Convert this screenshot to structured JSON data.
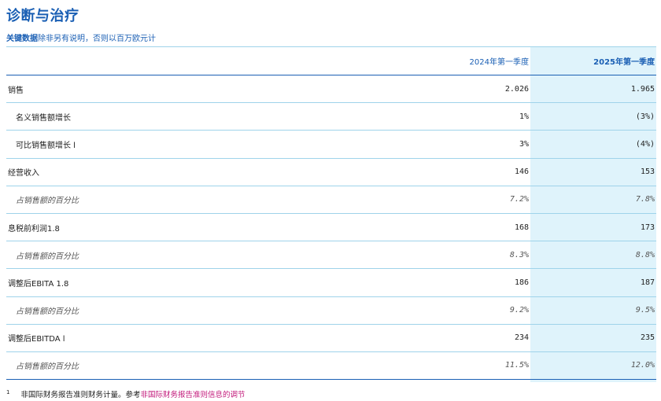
{
  "title": "诊断与治疗",
  "subtitle": {
    "strong": "关键数据",
    "rest": "除非另有说明，否则以百万欧元计"
  },
  "table": {
    "headers": {
      "label": "",
      "prev": "2024年第一季度",
      "curr": "2025年第一季度"
    },
    "rows": [
      {
        "label": "销售",
        "prev": "2.026",
        "curr": "1.965",
        "indent": false,
        "pct": false
      },
      {
        "label": "名义销售额增长",
        "prev": "1%",
        "curr": "(3%)",
        "indent": true,
        "pct": false
      },
      {
        "label": "可比销售额增长 l",
        "prev": "3%",
        "curr": "(4%)",
        "indent": true,
        "pct": false
      },
      {
        "label": "经营收入",
        "prev": "146",
        "curr": "153",
        "indent": false,
        "pct": false
      },
      {
        "label": "占销售额的百分比",
        "prev": "7.2%",
        "curr": "7.8%",
        "indent": true,
        "pct": true
      },
      {
        "label": "息税前利润1.8",
        "prev": "168",
        "curr": "173",
        "indent": false,
        "pct": false
      },
      {
        "label": "占销售额的百分比",
        "prev": "8.3%",
        "curr": "8.8%",
        "indent": true,
        "pct": true
      },
      {
        "label": "调整后EBITA 1.8",
        "prev": "186",
        "curr": "187",
        "indent": false,
        "pct": false
      },
      {
        "label": "占销售额的百分比",
        "prev": "9.2%",
        "curr": "9.5%",
        "indent": true,
        "pct": true
      },
      {
        "label": "调整后EBITDA l",
        "prev": "234",
        "curr": "235",
        "indent": false,
        "pct": false
      },
      {
        "label": "占销售额的百分比",
        "prev": "11.5%",
        "curr": "12.0%",
        "indent": true,
        "pct": true
      }
    ]
  },
  "footnote": {
    "mark": "1",
    "text": "非国际财务报告准则财务计量。参考",
    "link": "非国际财务报告准则信息的调节"
  }
}
